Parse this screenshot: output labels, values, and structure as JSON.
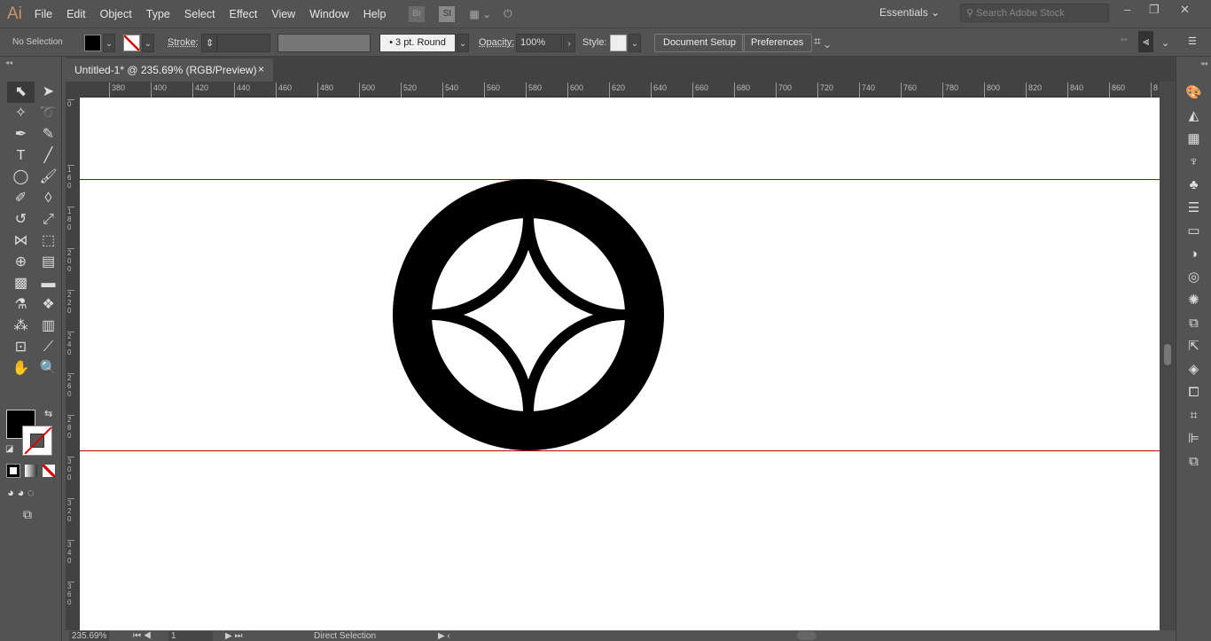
{
  "app": {
    "logo": "Ai",
    "menus": [
      "File",
      "Edit",
      "Object",
      "Type",
      "Select",
      "Effect",
      "View",
      "Window",
      "Help"
    ],
    "bridge": "Br",
    "stock": "St",
    "workspace": "Essentials",
    "search_placeholder": "Search Adobe Stock"
  },
  "control": {
    "selection": "No Selection",
    "stroke_label": "Stroke:",
    "brush": "3 pt. Round",
    "opacity_label": "Opacity:",
    "opacity": "100%",
    "style_label": "Style:",
    "document_setup": "Document Setup",
    "preferences": "Preferences",
    "fill_color": "#000000"
  },
  "document": {
    "tab_title": "Untitled-1* @ 235.69% (RGB/Preview)",
    "close": "×"
  },
  "rulers": {
    "horizontal": [
      "380",
      "400",
      "420",
      "440",
      "460",
      "480",
      "500",
      "520",
      "540",
      "560",
      "580",
      "600",
      "620",
      "640",
      "660",
      "680",
      "700",
      "720",
      "740",
      "760",
      "780",
      "800",
      "820",
      "840",
      "860",
      "8"
    ],
    "vertical": [
      "0",
      "160",
      "180",
      "200",
      "220",
      "240",
      "260",
      "280",
      "300",
      "320",
      "340",
      "360"
    ]
  },
  "guides_color": "#b30000",
  "status": {
    "zoom": "235.69%",
    "artboard": "1",
    "tool": "Direct Selection"
  }
}
